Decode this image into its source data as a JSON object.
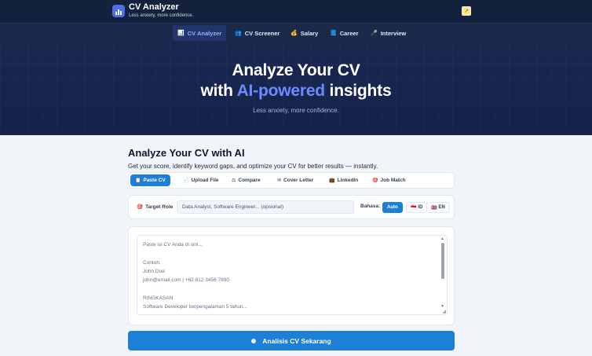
{
  "header": {
    "app_title": "CV Analyzer",
    "app_subtitle": "Less anxiety, more confidence.",
    "logo_icon": "chart-icon",
    "avatar_icon": "chart-up-icon"
  },
  "nav": {
    "items": [
      {
        "label": "CV Analyzer",
        "icon": "📊",
        "active": true
      },
      {
        "label": "CV Screener",
        "icon": "👥",
        "active": false
      },
      {
        "label": "Salary",
        "icon": "💰",
        "active": false
      },
      {
        "label": "Career",
        "icon": "📘",
        "active": false
      },
      {
        "label": "Interview",
        "icon": "🎤",
        "active": false
      }
    ]
  },
  "hero": {
    "line1": "Analyze Your CV",
    "line2_prefix": "with ",
    "line2_accent": "AI-powered",
    "line2_suffix": " insights",
    "tagline": "Less anxiety, more confidence."
  },
  "main": {
    "title": "Analyze Your CV with AI",
    "description": "Get your score, identify keyword gaps, and optimize your CV for better results — instantly."
  },
  "tabs": [
    {
      "label": "Paste CV",
      "icon": "📋",
      "active": true
    },
    {
      "label": "Upload File",
      "icon": "📄",
      "active": false
    },
    {
      "label": "Compare",
      "icon": "⚖",
      "active": false
    },
    {
      "label": "Cover Letter",
      "icon": "✉",
      "active": false
    },
    {
      "label": "LinkedIn",
      "icon": "💼",
      "active": false
    },
    {
      "label": "Job Match",
      "icon": "🎯",
      "active": false
    }
  ],
  "target_role": {
    "label": "Target Role",
    "icon": "🎯",
    "placeholder": "Data Analyst, Software Engineer... (opsional)",
    "value": ""
  },
  "language": {
    "label": "Bahasa:",
    "options": [
      {
        "label": "Auto",
        "prefix": "",
        "active": true
      },
      {
        "label": "ID",
        "prefix": "🇮🇩",
        "active": false
      },
      {
        "label": "EN",
        "prefix": "🇬🇧",
        "active": false
      }
    ]
  },
  "cv_input": {
    "placeholder_lines": [
      "Paste isi CV Anda di sini...",
      "",
      "Contoh:",
      "John Doe",
      "john@email.com | +62 812 3456 7890",
      "",
      "RINGKASAN",
      "Software Developer berpengalaman 5 tahun..."
    ]
  },
  "analyze_button": {
    "label": "Analisis CV Sekarang"
  },
  "colors": {
    "accent": "#1d7fd6",
    "hero_accent": "#6b8cff",
    "header_bg": "#14213d"
  }
}
